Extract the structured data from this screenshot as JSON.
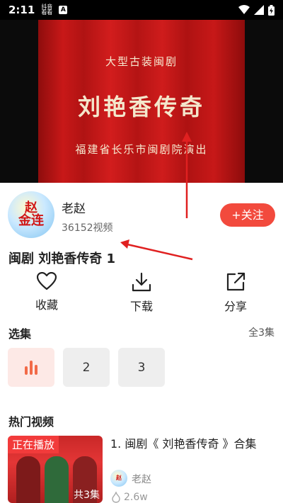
{
  "status_bar": {
    "time": "2:11",
    "badge_line1": "抖音",
    "badge_line2": "看看",
    "a_icon": "A",
    "icons": [
      "wifi-icon",
      "signal-icon",
      "battery-icon"
    ]
  },
  "video": {
    "subtitle": "大型古装闽剧",
    "title": "刘艳香传奇",
    "footer": "福建省长乐市闽剧院演出"
  },
  "uploader": {
    "avatar_text_line1": "赵",
    "avatar_text_line2": "金连",
    "name": "老赵",
    "video_count": "36152视频",
    "follow_label": "+关注"
  },
  "video_title": "闽剧 刘艳香传奇 1",
  "actions": [
    {
      "label": "收藏",
      "icon": "heart-icon"
    },
    {
      "label": "下载",
      "icon": "download-icon"
    },
    {
      "label": "分享",
      "icon": "share-icon"
    }
  ],
  "episodes": {
    "section_title": "选集",
    "total": "全3集",
    "items": [
      "",
      "2",
      "3"
    ]
  },
  "hot": {
    "section_title": "热门视频",
    "items": [
      {
        "badge": "正在播放",
        "episodes": "共3集",
        "title": "1. 闽剧《 刘艳香传奇 》合集",
        "uploader": "老赵",
        "views": "2.6w"
      }
    ]
  },
  "colors": {
    "accent": "#f24a3d",
    "annotation": "#e02020"
  }
}
